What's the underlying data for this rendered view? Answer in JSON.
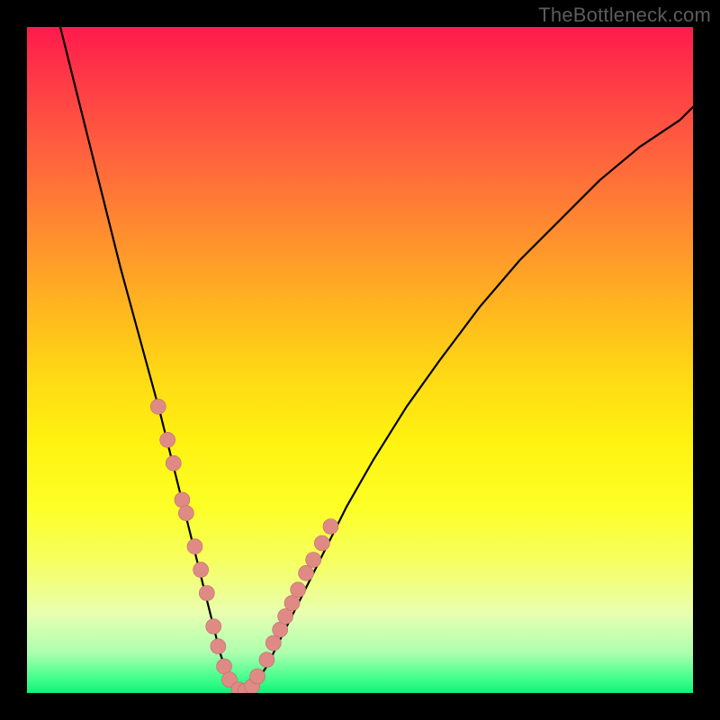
{
  "watermark": "TheBottleneck.com",
  "colors": {
    "gradient_top": "#ff1a4d",
    "gradient_bottom": "#14f07a",
    "curve": "#000000",
    "dots": "#e08a86",
    "frame": "#000000"
  },
  "chart_data": {
    "type": "line",
    "title": "",
    "xlabel": "",
    "ylabel": "",
    "xlim": [
      0,
      100
    ],
    "ylim": [
      0,
      100
    ],
    "grid": false,
    "legend": false,
    "series": [
      {
        "name": "bottleneck-curve",
        "x": [
          5,
          8,
          11,
          14,
          17,
          20,
          22,
          24,
          26,
          27,
          28,
          29,
          30,
          31,
          32,
          33,
          34,
          36,
          38,
          41,
          44,
          48,
          52,
          57,
          62,
          68,
          74,
          80,
          86,
          92,
          98,
          100
        ],
        "y": [
          100,
          88,
          76,
          64,
          53,
          42,
          34,
          26,
          18,
          14,
          10,
          6,
          3,
          1,
          0,
          0,
          1,
          4,
          8,
          14,
          20,
          28,
          35,
          43,
          50,
          58,
          65,
          71,
          77,
          82,
          86,
          88
        ]
      }
    ],
    "highlight_points": {
      "name": "sample-dots",
      "x": [
        19.7,
        21.1,
        22.0,
        23.3,
        23.9,
        25.2,
        26.1,
        27.0,
        28.0,
        28.7,
        29.6,
        30.4,
        31.8,
        32.8,
        33.8,
        34.6,
        36.0,
        37.0,
        38.0,
        38.8,
        39.8,
        40.7,
        41.9,
        43.0,
        44.3,
        45.6
      ],
      "y": [
        43.0,
        38.0,
        34.5,
        29.0,
        27.0,
        22.0,
        18.5,
        15.0,
        10.0,
        7.0,
        4.0,
        2.0,
        0.5,
        0.3,
        1.0,
        2.5,
        5.0,
        7.5,
        9.5,
        11.5,
        13.5,
        15.5,
        18.0,
        20.0,
        22.5,
        25.0
      ]
    }
  }
}
